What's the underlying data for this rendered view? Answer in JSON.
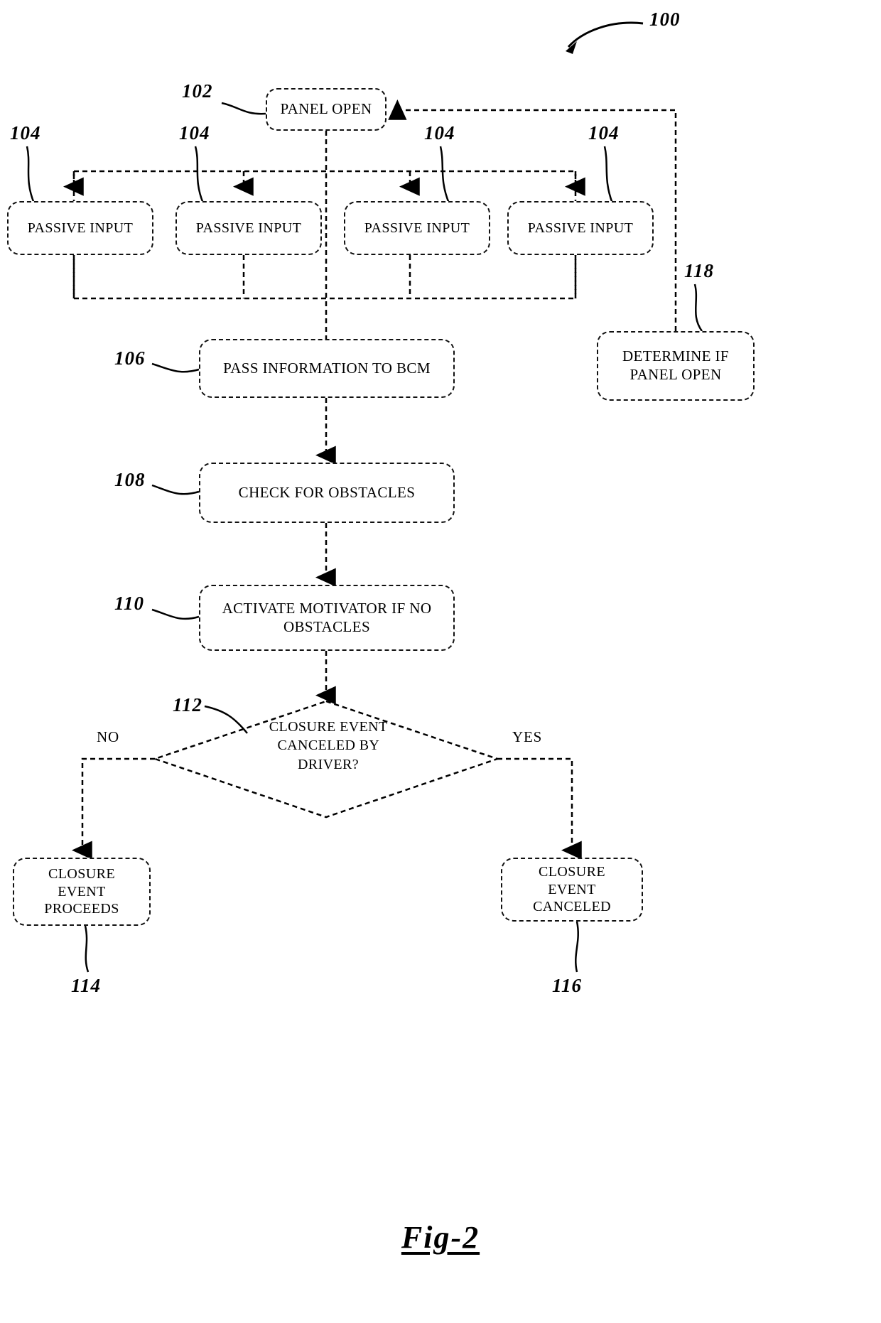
{
  "figure": {
    "caption": "Fig-2",
    "system_ref": "100"
  },
  "nodes": {
    "panel_open": {
      "label": "PANEL OPEN",
      "ref": "102"
    },
    "passive_inputs": [
      {
        "label": "PASSIVE INPUT",
        "ref": "104"
      },
      {
        "label": "PASSIVE INPUT",
        "ref": "104"
      },
      {
        "label": "PASSIVE INPUT",
        "ref": "104"
      },
      {
        "label": "PASSIVE INPUT",
        "ref": "104"
      }
    ],
    "pass_information": {
      "label": "PASS INFORMATION TO BCM",
      "ref": "106"
    },
    "check_obstacles": {
      "label": "CHECK FOR OBSTACLES",
      "ref": "108"
    },
    "activate_motivator": {
      "line1": "ACTIVATE MOTIVATOR IF NO",
      "line2": "OBSTACLES",
      "ref": "110"
    },
    "determine_panel_open": {
      "line1": "DETERMINE IF",
      "line2": "PANEL OPEN",
      "ref": "118"
    },
    "decision": {
      "line1": "CLOSURE",
      "line2": "EVENT",
      "line3": "CANCELED BY",
      "line4": "DRIVER?",
      "ref": "112"
    },
    "closure_proceeds": {
      "line1": "CLOSURE",
      "line2": "EVENT",
      "line3": "PROCEEDS",
      "ref": "114"
    },
    "closure_canceled": {
      "line1": "CLOSURE EVENT",
      "line2": "CANCELED",
      "ref": "116"
    }
  },
  "branch_labels": {
    "no": "NO",
    "yes": "YES"
  },
  "colors": {
    "ink": "#000000",
    "background": "#ffffff"
  }
}
